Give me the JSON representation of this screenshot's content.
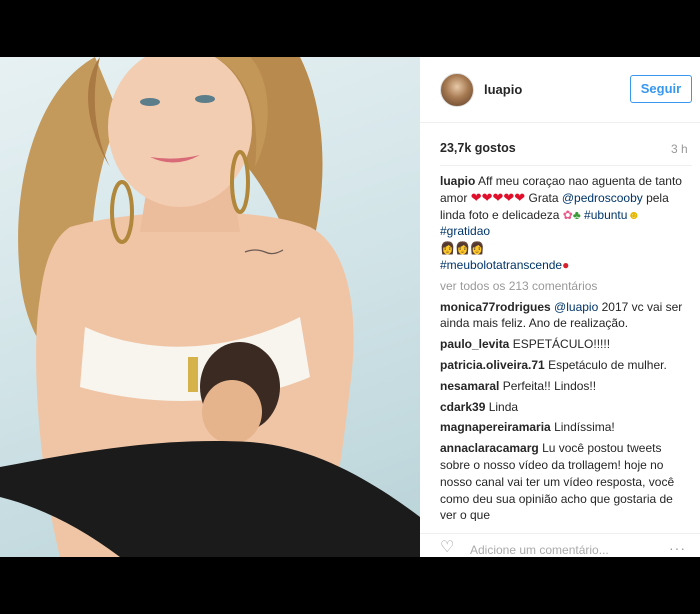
{
  "post": {
    "username": "luapio",
    "follow_label": "Seguir",
    "likes": "23,7k gostos",
    "time": "3 h",
    "caption": {
      "user": "luapio",
      "text1": "Aff meu coraçao nao aguenta de tanto amor",
      "text2": " Grata ",
      "mention": "@pedroscooby",
      "text3": " pela linda foto e delicadeza",
      "tag1": "#ubuntu",
      "tag2": "#gratidao",
      "tag3": "#meubolotatranscende"
    },
    "view_all": "ver todos os 213 comentários",
    "comments": [
      {
        "user": "monica77rodrigues",
        "mention": "@luapio",
        "text": " 2017 vc vai ser ainda mais feliz. Ano de realização."
      },
      {
        "user": "paulo_levita",
        "mention": "",
        "text": " ESPETÁCULO!!!!!"
      },
      {
        "user": "patricia.oliveira.71",
        "mention": "",
        "text": " Espetáculo de mulher."
      },
      {
        "user": "nesamaral",
        "mention": "",
        "text": " Perfeita!! Lindos!!"
      },
      {
        "user": "cdark39",
        "mention": "",
        "text": " Linda"
      },
      {
        "user": "magnapereiramaria",
        "mention": "",
        "text": " Lindíssima!"
      },
      {
        "user": "annaclaracamarg",
        "mention": "",
        "text": " Lu você postou tweets sobre o nosso vídeo da trollagem! hoje no nosso canal vai ter um vídeo resposta, você como deu sua opinião acho que gostaria de ver o que"
      }
    ],
    "add_comment_placeholder": "Adicione um comentário...",
    "more_glyph": "···"
  },
  "colors": {
    "link": "#003569",
    "follow": "#3897f0",
    "heart": "#e0102c"
  },
  "icons": [
    "heart-icon",
    "more-options-icon",
    "avatar"
  ]
}
